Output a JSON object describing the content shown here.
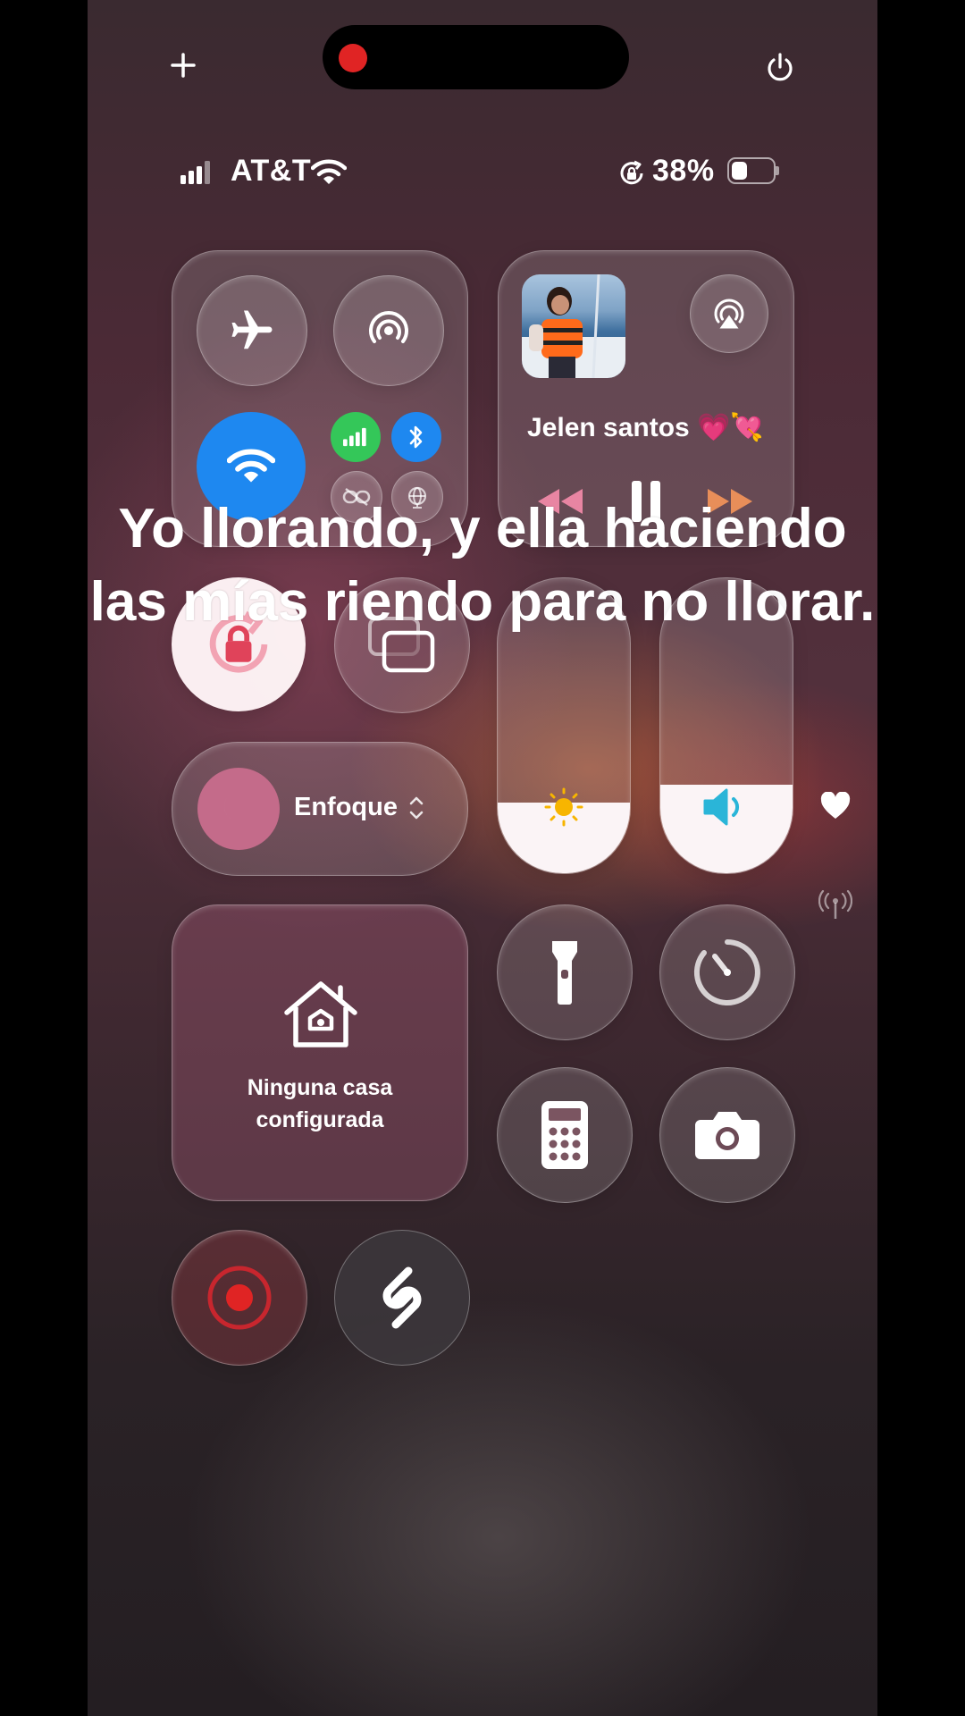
{
  "status_bar": {
    "carrier": "AT&T",
    "battery_percent": "38%",
    "battery_level": 0.38
  },
  "media": {
    "song_title": "Jelen santos 💗💘"
  },
  "caption": {
    "line1": "Yo llorando, y ella haciendo",
    "line2": "las mías riendo para no llorar."
  },
  "focus": {
    "label": "Enfoque"
  },
  "home": {
    "label_line1": "Ninguna casa",
    "label_line2": "configurada"
  },
  "sliders": {
    "brightness_level": 0.24,
    "volume_level": 0.3
  },
  "colors": {
    "wifi_active": "#1e88f0",
    "cellular_active": "#34c759",
    "bluetooth_active": "#1e88f0",
    "rotation_lock": "#e0435a",
    "record": "#e02424"
  }
}
